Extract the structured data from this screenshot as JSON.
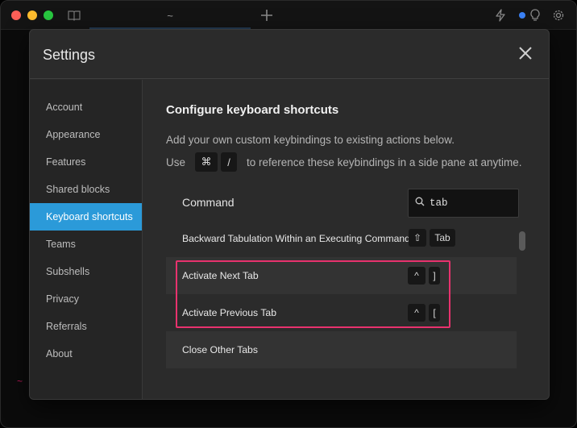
{
  "app": {
    "tab_title": "~",
    "prompt": "~"
  },
  "modal": {
    "title": "Settings",
    "close_icon": "close-icon"
  },
  "sidebar": {
    "items": [
      {
        "label": "Account"
      },
      {
        "label": "Appearance"
      },
      {
        "label": "Features"
      },
      {
        "label": "Shared blocks"
      },
      {
        "label": "Keyboard shortcuts",
        "active": true
      },
      {
        "label": "Teams"
      },
      {
        "label": "Subshells"
      },
      {
        "label": "Privacy"
      },
      {
        "label": "Referrals"
      },
      {
        "label": "About"
      }
    ]
  },
  "content": {
    "title": "Configure keyboard shortcuts",
    "description": "Add your own custom keybindings to existing actions below.",
    "use_label": "Use",
    "use_keys": [
      "⌘",
      "/"
    ],
    "use_suffix": "to reference these keybindings in a side pane at anytime.",
    "command_header": "Command",
    "search": {
      "value": "tab",
      "icon": "search-icon"
    },
    "rows": [
      {
        "label": "Backward Tabulation Within an Executing Command",
        "keys": [
          "⇧",
          "Tab"
        ]
      },
      {
        "label": "Activate Next Tab",
        "keys": [
          "^",
          "]"
        ]
      },
      {
        "label": "Activate Previous Tab",
        "keys": [
          "^",
          "["
        ]
      },
      {
        "label": "Close Other Tabs",
        "keys": []
      }
    ]
  },
  "colors": {
    "accent": "#2b9ad9",
    "highlight": "#e8326e",
    "modal_bg": "#2b2b2b"
  }
}
